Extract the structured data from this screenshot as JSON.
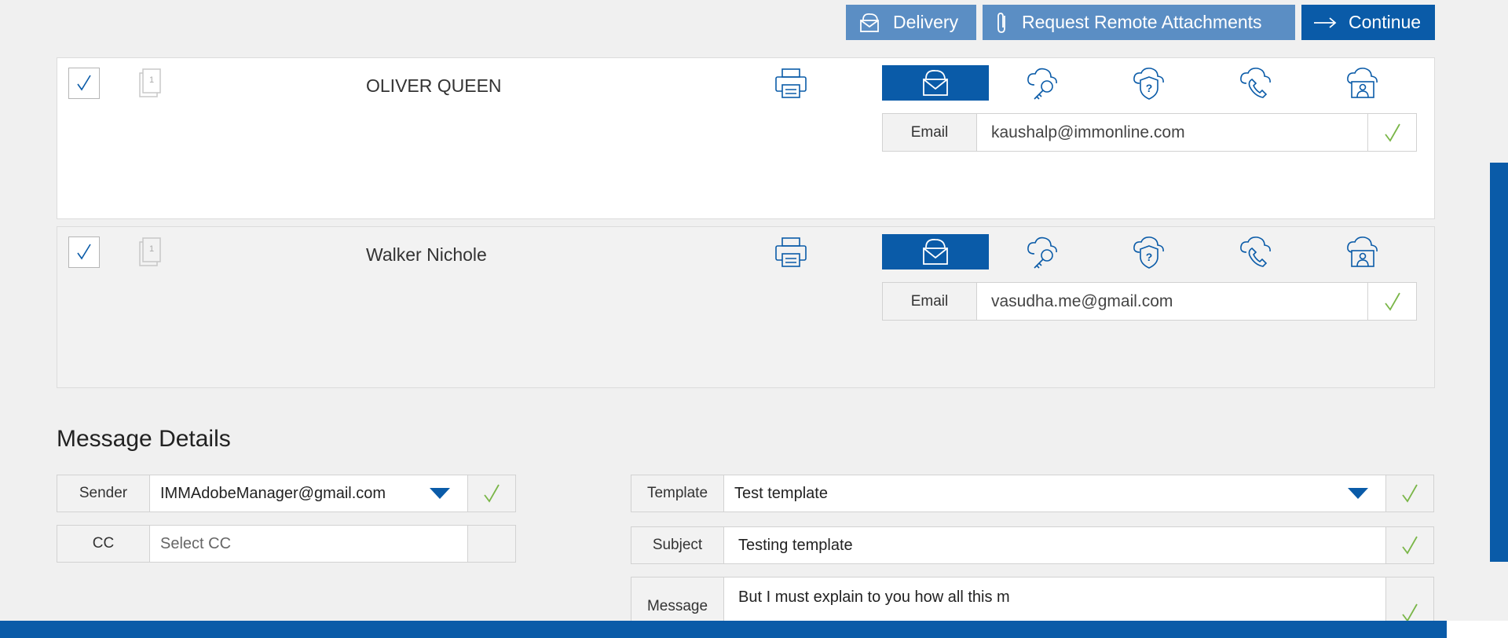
{
  "toolbar": {
    "delivery_label": "Delivery",
    "remote_label": "Request Remote Attachments",
    "continue_label": "Continue"
  },
  "recipients": [
    {
      "name": "OLIVER QUEEN",
      "checked": true,
      "doc_count": "1",
      "selected_method": "email",
      "email_label": "Email",
      "email": "kaushalp@immonline.com"
    },
    {
      "name": "Walker Nichole",
      "checked": true,
      "doc_count": "1",
      "selected_method": "email",
      "email_label": "Email",
      "email": "vasudha.me@gmail.com"
    }
  ],
  "message_details": {
    "title": "Message Details",
    "sender_label": "Sender",
    "sender_value": "IMMAdobeManager@gmail.com",
    "cc_label": "CC",
    "cc_placeholder": "Select CC",
    "template_label": "Template",
    "template_value": "Test template",
    "subject_label": "Subject",
    "subject_value": "Testing template",
    "message_label": "Message",
    "message_value": "But I must explain to you how all this m"
  },
  "colors": {
    "primary": "#0a5ba8",
    "secondary_button": "#5b8ec4",
    "check_green": "#7ab648",
    "background": "#f0f0f0"
  },
  "icons": {
    "method_icons": [
      "envelope-icon",
      "key-cloud-icon",
      "shield-question-cloud-icon",
      "phone-cloud-icon",
      "id-card-cloud-icon"
    ]
  }
}
